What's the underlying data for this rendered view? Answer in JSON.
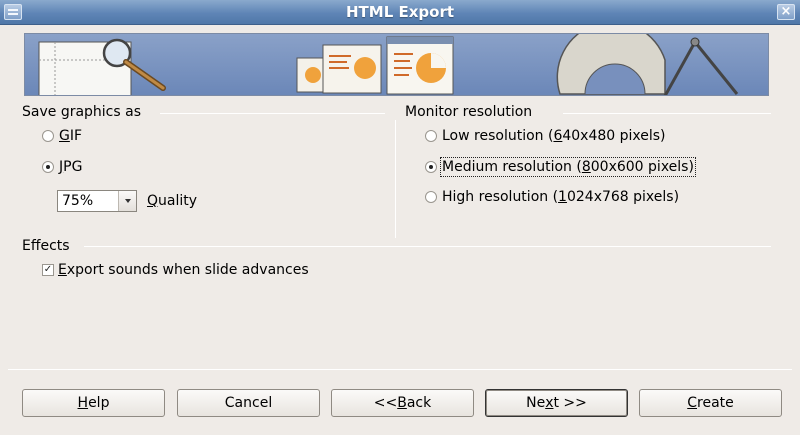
{
  "window": {
    "title": "HTML Export",
    "close_glyph": "×"
  },
  "save_graphics": {
    "title": "Save graphics as",
    "options": [
      {
        "label_pre": "",
        "label_mnemonic": "G",
        "label_post": "IF",
        "selected": false
      },
      {
        "label_pre": "",
        "label_mnemonic": "J",
        "label_post": "PG",
        "selected": true
      }
    ],
    "quality_value": "75%",
    "quality_label_mnemonic": "Q",
    "quality_label_rest": "uality"
  },
  "monitor_resolution": {
    "title": "Monitor resolution",
    "options": [
      {
        "label_pre": "Low resolution (",
        "label_mnemonic": "6",
        "label_post": "40x480 pixels)",
        "selected": false
      },
      {
        "label_pre": "Medium resolution (",
        "label_mnemonic": "8",
        "label_post": "00x600 pixels)",
        "selected": true
      },
      {
        "label_pre": "High resolution (",
        "label_mnemonic": "1",
        "label_post": "024x768 pixels)",
        "selected": false
      }
    ]
  },
  "effects": {
    "title": "Effects",
    "export_sounds": {
      "label_pre": "",
      "label_mnemonic": "E",
      "label_post": "xport sounds when slide advances",
      "checked": true
    }
  },
  "buttons": {
    "help": {
      "pre": "",
      "mn": "H",
      "post": "elp"
    },
    "cancel": {
      "pre": "Cancel",
      "mn": "",
      "post": ""
    },
    "back": {
      "pre": "<< ",
      "mn": "B",
      "post": "ack"
    },
    "next": {
      "pre": "Ne",
      "mn": "x",
      "post": "t >>"
    },
    "create": {
      "pre": "",
      "mn": "C",
      "post": "reate"
    }
  },
  "icons": [
    "window-menu-icon",
    "close-icon",
    "magnifier-icon",
    "pie-chart-icon",
    "protractor-icon",
    "compass-icon",
    "dropdown-arrow-icon",
    "checkmark-icon"
  ],
  "colors": {
    "titlebar": "#5f85b6",
    "dialog_bg": "#efebe7",
    "banner": "#7890bd"
  }
}
